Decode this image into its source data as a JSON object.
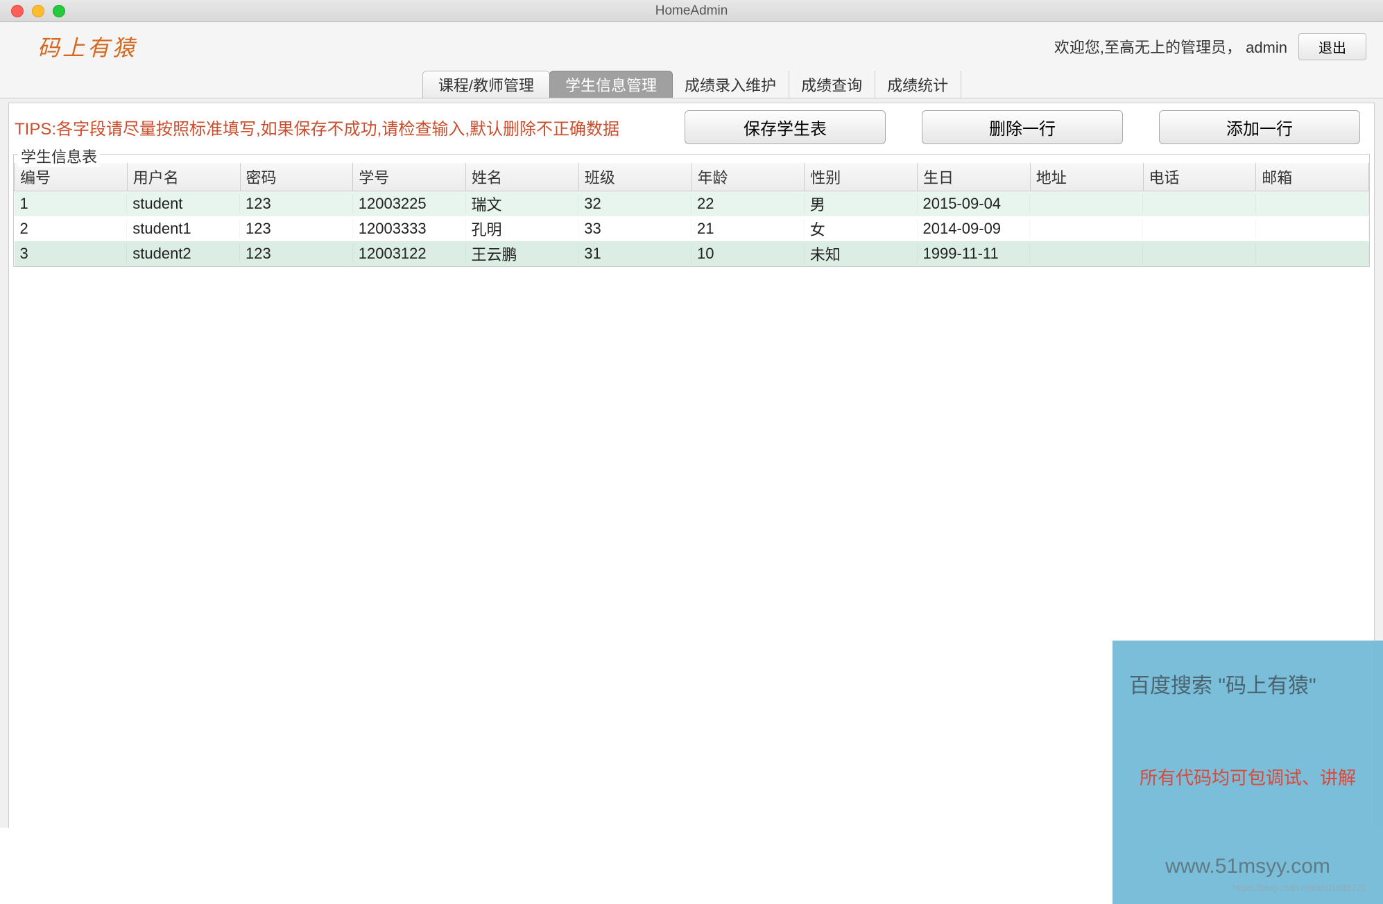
{
  "window": {
    "title": "HomeAdmin"
  },
  "header": {
    "logo": "码上有猿",
    "welcome_prefix": "欢迎您,至高无上的管理员，",
    "username": "admin",
    "logout_label": "退出"
  },
  "tabs": [
    {
      "label": "课程/教师管理",
      "active": false
    },
    {
      "label": "学生信息管理",
      "active": true
    },
    {
      "label": "成绩录入维护",
      "active": false
    },
    {
      "label": "成绩查询",
      "active": false
    },
    {
      "label": "成绩统计",
      "active": false
    }
  ],
  "tips": {
    "prefix": "TIPS:",
    "text": "各字段请尽量按照标准填写,如果保存不成功,请检查输入,默认删除不正确数据"
  },
  "actions": {
    "save_label": "保存学生表",
    "delete_label": "删除一行",
    "add_label": "添加一行"
  },
  "table": {
    "legend": "学生信息表",
    "columns": [
      "编号",
      "用户名",
      "密码",
      "学号",
      "姓名",
      "班级",
      "年龄",
      "性别",
      "生日",
      "地址",
      "电话",
      "邮箱"
    ],
    "rows": [
      {
        "id": "1",
        "username": "student",
        "password": "123",
        "sno": "12003225",
        "name": "瑞文",
        "class": "32",
        "age": "22",
        "gender": "男",
        "birthday": "2015-09-04",
        "address": "",
        "phone": "",
        "email": ""
      },
      {
        "id": "2",
        "username": "student1",
        "password": "123",
        "sno": "12003333",
        "name": "孔明",
        "class": "33",
        "age": "21",
        "gender": "女",
        "birthday": "2014-09-09",
        "address": "",
        "phone": "",
        "email": ""
      },
      {
        "id": "3",
        "username": "student2",
        "password": "123",
        "sno": "12003122",
        "name": "王云鹏",
        "class": "31",
        "age": "10",
        "gender": "未知",
        "birthday": "1999-11-11",
        "address": "",
        "phone": "",
        "email": ""
      }
    ]
  },
  "watermark": {
    "line1": "百度搜索 \"码上有猿\"",
    "line2": "所有代码均可包调试、讲解",
    "line3": "www.51msyy.com",
    "small": "https://blog.csdn.net/a501936721"
  }
}
